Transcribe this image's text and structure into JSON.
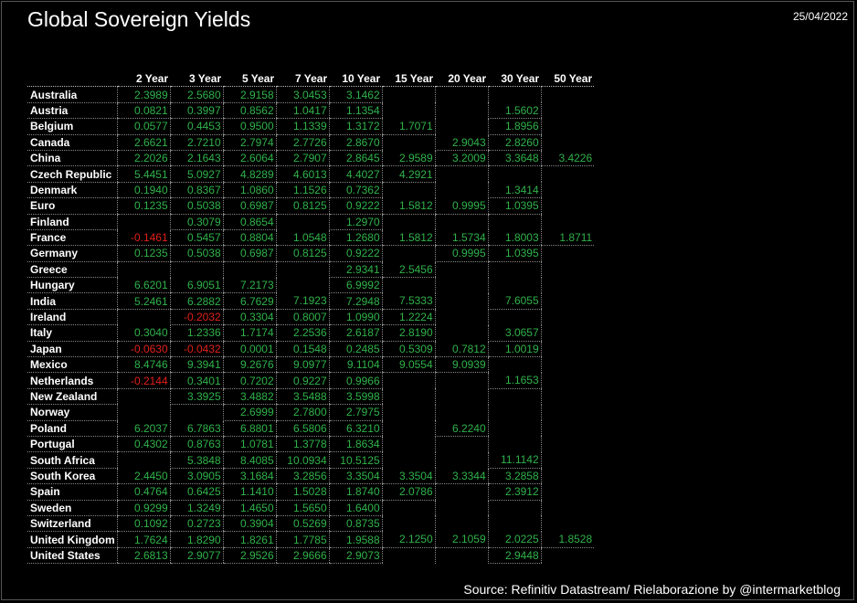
{
  "header": {
    "title": "Global Sovereign Yields",
    "date": "25/04/2022"
  },
  "footer": {
    "source": "Source: Refinitiv Datastream/ Rielaborazione by @intermarketblog"
  },
  "colors": {
    "background": "#000000",
    "positive": "#2fb24a",
    "negative": "#e0201b",
    "text": "#ffffff"
  },
  "chart_data": {
    "type": "table",
    "title": "Global Sovereign Yields",
    "columns": [
      "2 Year",
      "3 Year",
      "5 Year",
      "7 Year",
      "10 Year",
      "15 Year",
      "20 Year",
      "30 Year",
      "50 Year"
    ],
    "rows": [
      {
        "country": "Australia",
        "values": [
          "2.3989",
          "2.5680",
          "2.9158",
          "3.0453",
          "3.1462",
          "",
          "",
          "",
          ""
        ]
      },
      {
        "country": "Austria",
        "values": [
          "0.0821",
          "0.3997",
          "0.8562",
          "1.0417",
          "1.1354",
          "",
          "",
          "1.5602",
          ""
        ]
      },
      {
        "country": "Belgium",
        "values": [
          "0.0577",
          "0.4453",
          "0.9500",
          "1.1339",
          "1.3172",
          "1.7071",
          "",
          "1.8956",
          ""
        ]
      },
      {
        "country": "Canada",
        "values": [
          "2.6621",
          "2.7210",
          "2.7974",
          "2.7726",
          "2.8670",
          "",
          "2.9043",
          "2.8260",
          ""
        ]
      },
      {
        "country": "China",
        "values": [
          "2.2026",
          "2.1643",
          "2.6064",
          "2.7907",
          "2.8645",
          "2.9589",
          "3.2009",
          "3.3648",
          "3.4226"
        ]
      },
      {
        "country": "Czech Republic",
        "values": [
          "5.4451",
          "5.0927",
          "4.8289",
          "4.6013",
          "4.4027",
          "4.2921",
          "",
          "",
          ""
        ]
      },
      {
        "country": "Denmark",
        "values": [
          "0.1940",
          "0.8367",
          "1.0860",
          "1.1526",
          "0.7362",
          "",
          "",
          "1.3414",
          ""
        ]
      },
      {
        "country": "Euro",
        "values": [
          "0.1235",
          "0.5038",
          "0.6987",
          "0.8125",
          "0.9222",
          "1.5812",
          "0.9995",
          "1.0395",
          ""
        ]
      },
      {
        "country": "Finland",
        "values": [
          "",
          "0.3079",
          "0.8654",
          "",
          "1.2970",
          "",
          "",
          "",
          ""
        ]
      },
      {
        "country": "France",
        "values": [
          "-0.1461",
          "0.5457",
          "0.8804",
          "1.0548",
          "1.2680",
          "1.5812",
          "1.5734",
          "1.8003",
          "1.8711"
        ]
      },
      {
        "country": "Germany",
        "values": [
          "0.1235",
          "0.5038",
          "0.6987",
          "0.8125",
          "0.9222",
          "",
          "0.9995",
          "1.0395",
          ""
        ]
      },
      {
        "country": "Greece",
        "values": [
          "",
          "",
          "",
          "",
          "2.9341",
          "2.5456",
          "",
          "",
          ""
        ]
      },
      {
        "country": "Hungary",
        "values": [
          "6.6201",
          "6.9051",
          "7.2173",
          "",
          "6.9992",
          "",
          "",
          "",
          ""
        ]
      },
      {
        "country": "India",
        "values": [
          "5.2461",
          "6.2882",
          "6.7629",
          "7.1923",
          "7.2948",
          "7.5333",
          "",
          "7.6055",
          ""
        ]
      },
      {
        "country": "Ireland",
        "values": [
          "",
          "-0.2032",
          "0.3304",
          "0.8007",
          "1.0990",
          "1.2224",
          "",
          "",
          ""
        ]
      },
      {
        "country": "Italy",
        "values": [
          "0.3040",
          "1.2336",
          "1.7174",
          "2.2536",
          "2.6187",
          "2.8190",
          "",
          "3.0657",
          ""
        ]
      },
      {
        "country": "Japan",
        "values": [
          "-0.0630",
          "-0.0432",
          "0.0001",
          "0.1548",
          "0.2485",
          "0.5309",
          "0.7812",
          "1.0019",
          ""
        ]
      },
      {
        "country": "Mexico",
        "values": [
          "8.4746",
          "9.3941",
          "9.2676",
          "9.0977",
          "9.1104",
          "9.0554",
          "9.0939",
          "",
          ""
        ]
      },
      {
        "country": "Netherlands",
        "values": [
          "-0.2144",
          "0.3401",
          "0.7202",
          "0.9227",
          "0.9966",
          "",
          "",
          "1.1653",
          ""
        ]
      },
      {
        "country": "New Zealand",
        "values": [
          "",
          "3.3925",
          "3.4882",
          "3.5488",
          "3.5998",
          "",
          "",
          "",
          ""
        ]
      },
      {
        "country": "Norway",
        "values": [
          "",
          "",
          "2.6999",
          "2.7800",
          "2.7975",
          "",
          "",
          "",
          ""
        ]
      },
      {
        "country": "Poland",
        "values": [
          "6.2037",
          "6.7863",
          "6.8801",
          "6.5806",
          "6.3210",
          "",
          "6.2240",
          "",
          ""
        ]
      },
      {
        "country": "Portugal",
        "values": [
          "0.4302",
          "0.8763",
          "1.0781",
          "1.3778",
          "1.8634",
          "",
          "",
          "",
          ""
        ]
      },
      {
        "country": "South Africa",
        "values": [
          "",
          "5.3848",
          "8.4085",
          "10.0934",
          "10.5125",
          "",
          "",
          "11.1142",
          ""
        ]
      },
      {
        "country": "South Korea",
        "values": [
          "2.4450",
          "3.0905",
          "3.1684",
          "3.2856",
          "3.3504",
          "3.3504",
          "3.3344",
          "3.2858",
          ""
        ]
      },
      {
        "country": "Spain",
        "values": [
          "0.4764",
          "0.6425",
          "1.1410",
          "1.5028",
          "1.8740",
          "2.0786",
          "",
          "2.3912",
          ""
        ]
      },
      {
        "country": "Sweden",
        "values": [
          "0.9299",
          "1.3249",
          "1.4650",
          "1.5650",
          "1.6400",
          "",
          "",
          "",
          ""
        ]
      },
      {
        "country": "Switzerland",
        "values": [
          "0.1092",
          "0.2723",
          "0.3904",
          "0.5269",
          "0.8735",
          "",
          "",
          "",
          ""
        ]
      },
      {
        "country": "United Kingdom",
        "values": [
          "1.7624",
          "1.8290",
          "1.8261",
          "1.7785",
          "1.9588",
          "2.1250",
          "2.1059",
          "2.0225",
          "1.8528"
        ]
      },
      {
        "country": "United States",
        "values": [
          "2.6813",
          "2.9077",
          "2.9526",
          "2.9666",
          "2.9073",
          "",
          "",
          "2.9448",
          ""
        ]
      }
    ]
  }
}
